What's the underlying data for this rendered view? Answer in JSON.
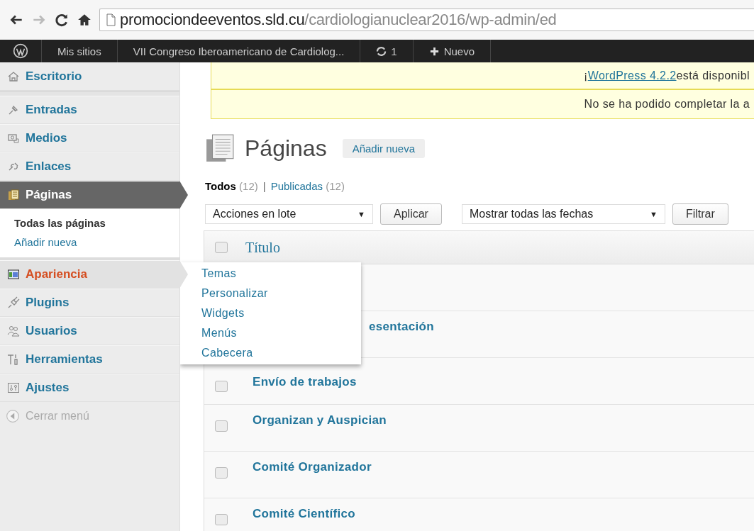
{
  "browser": {
    "url_domain": "promociondeeventos.sld.cu",
    "url_path": "/cardiologianuclear2016/wp-admin/ed"
  },
  "admin_bar": {
    "items": [
      {
        "kind": "logo"
      },
      {
        "kind": "text",
        "label": "Mis sitios"
      },
      {
        "kind": "text",
        "label": "VII Congreso Iberoamericano de Cardiolog..."
      },
      {
        "kind": "updates",
        "label": "1"
      },
      {
        "kind": "new",
        "label": "Nuevo"
      }
    ]
  },
  "sidebar": {
    "items": [
      {
        "kind": "item",
        "label": "Escritorio",
        "selected": false,
        "hover": false
      },
      {
        "kind": "separator"
      },
      {
        "kind": "item",
        "label": "Entradas",
        "selected": false,
        "hover": false
      },
      {
        "kind": "item",
        "label": "Medios",
        "selected": false,
        "hover": false
      },
      {
        "kind": "item",
        "label": "Enlaces",
        "selected": false,
        "hover": false
      },
      {
        "kind": "item",
        "label": "Páginas",
        "selected": true,
        "hover": false,
        "children": [
          {
            "label": "Todas las páginas",
            "selected": true
          },
          {
            "label": "Añadir nueva",
            "selected": false
          }
        ]
      },
      {
        "kind": "item",
        "label": "Apariencia",
        "selected": false,
        "hover": true
      },
      {
        "kind": "item",
        "label": "Plugins",
        "selected": false,
        "hover": false
      },
      {
        "kind": "item",
        "label": "Usuarios",
        "selected": false,
        "hover": false
      },
      {
        "kind": "item",
        "label": "Herramientas",
        "selected": false,
        "hover": false
      },
      {
        "kind": "item",
        "label": "Ajustes",
        "selected": false,
        "hover": false
      },
      {
        "kind": "collapse",
        "label": "Cerrar menú"
      }
    ]
  },
  "flyout_menu": {
    "items": [
      "Temas",
      "Personalizar",
      "Widgets",
      "Menús",
      "Cabecera"
    ]
  },
  "notices": [
    {
      "prefix": "¡",
      "link": "WordPress 4.2.2",
      "text": " está disponibl"
    },
    {
      "text": "No se ha podido completar la a"
    }
  ],
  "page": {
    "title": "Páginas",
    "add_button": "Añadir nueva"
  },
  "filters": [
    {
      "label": "Todos",
      "count": "(12)",
      "selected": true
    },
    {
      "label": "Publicadas",
      "count": "(12)",
      "selected": false
    }
  ],
  "filter_separator": "|",
  "toolbar": {
    "bulk_select": "Acciones en lote",
    "bulk_caret": "▼",
    "apply": "Aplicar",
    "date_select": "Mostrar todas las fechas",
    "date_caret": "▼",
    "filter": "Filtrar"
  },
  "table": {
    "column_header": "Título",
    "header_checked": false,
    "rows": [
      {},
      {
        "covered_by_menu": true,
        "title": "esentación"
      },
      {
        "covered_by_menu": false,
        "checked": false,
        "title": "Envío de trabajos"
      },
      {
        "covered_by_menu": false,
        "checked": false,
        "title": "Organizan y Auspician"
      },
      {
        "covered_by_menu": false,
        "checked": false,
        "title": "Comité Organizador"
      },
      {
        "covered_by_menu": false,
        "checked": false,
        "title": "Comité Científico"
      }
    ]
  }
}
